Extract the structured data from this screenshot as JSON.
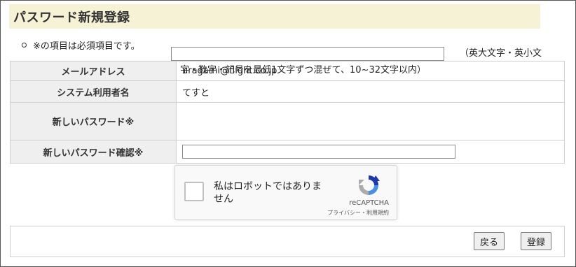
{
  "page": {
    "title": "パスワード新規登録",
    "required_note": "※の項目は必須項目です。"
  },
  "form": {
    "email": {
      "label": "メールアドレス",
      "value": "uragami@flight.co.jp"
    },
    "user_name": {
      "label": "システム利用者名",
      "value": "てすと"
    },
    "new_password": {
      "label": "新しいパスワード※",
      "value": "",
      "hint_line1": "（英大文字・英小文",
      "hint_line2": "字・数字・記号を最低1文字ずつ混ぜて、10~32文字以内）"
    },
    "confirm_password": {
      "label": "新しいパスワード確認※",
      "value": ""
    }
  },
  "recaptcha": {
    "label": "私はロボットではありません",
    "brand": "reCAPTCHA",
    "links": "プライバシー・利用規約",
    "checked": false
  },
  "buttons": {
    "back": "戻る",
    "register": "登録"
  }
}
